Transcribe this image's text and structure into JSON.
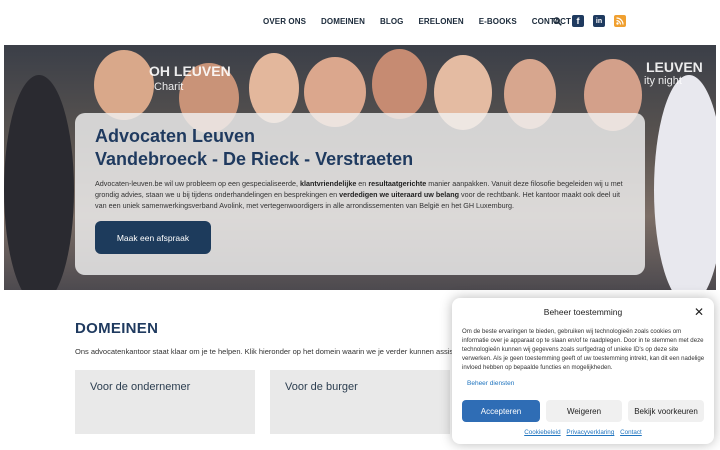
{
  "nav": {
    "items": [
      "OVER ONS",
      "DOMEINEN",
      "BLOG",
      "ERELONEN",
      "E-BOOKS",
      "CONTACT"
    ],
    "icons": [
      "search-icon",
      "facebook-icon",
      "linkedin-icon",
      "rss-icon"
    ]
  },
  "hero": {
    "title_line1": "Advocaten Leuven",
    "title_line2": "Vandebroeck - De Rieck - Verstraeten",
    "lead_part1": "Advocaten-leuven.be wil uw probleem op een gespecialiseerde, ",
    "lead_bold1": "klantvriendelijke",
    "lead_part2": " en ",
    "lead_bold2": "resultaatgerichte",
    "lead_part3": " manier aanpakken. Vanuit deze filosofie begeleiden wij u met grondig advies, staan we u bij tijdens onderhandelingen en besprekingen en ",
    "lead_bold3": "verdedigen we uiteraard uw belang",
    "lead_part4": " voor de rechtbank. Het kantoor maakt ook deel uit van een uniek samenwerkingsverband Avolink, met vertegenwoordigers in alle arrondissementen van België en het GH Luxemburg.",
    "cta": "Maak een afspraak",
    "background_signs": [
      "OH LEUVEN",
      "Charit",
      "LEUVEN",
      "ity night"
    ]
  },
  "domeinen": {
    "title": "DOMEINEN",
    "subtitle": "Ons advocatenkantoor staat klaar om je te helpen. Klik hieronder op het domein waarin we je verder kunnen assiste",
    "cards": [
      "Voor de ondernemer",
      "Voor de burger"
    ]
  },
  "consent": {
    "title": "Beheer toestemming",
    "body": "Om de beste ervaringen te bieden, gebruiken wij technologieën zoals cookies om informatie over je apparaat op te slaan en/of te raadplegen. Door in te stemmen met deze technologieën kunnen wij gegevens zoals surfgedrag of unieke ID's op deze site verwerken. Als je geen toestemming geeft of uw toestemming intrekt, kan dit een nadelige invloed hebben op bepaalde functies en mogelijkheden.",
    "manage": "Beheer diensten",
    "accept": "Accepteren",
    "deny": "Weigeren",
    "prefs": "Bekijk voorkeuren",
    "links": [
      "Cookiebeleid",
      "Privacyverklaring",
      "Contact"
    ]
  },
  "colors": {
    "brand_navy": "#1f3a5f",
    "button_navy": "#1d3b5c",
    "accept_blue": "#2f6db5",
    "link_blue": "#1e73be",
    "rss_orange": "#f0a030"
  }
}
